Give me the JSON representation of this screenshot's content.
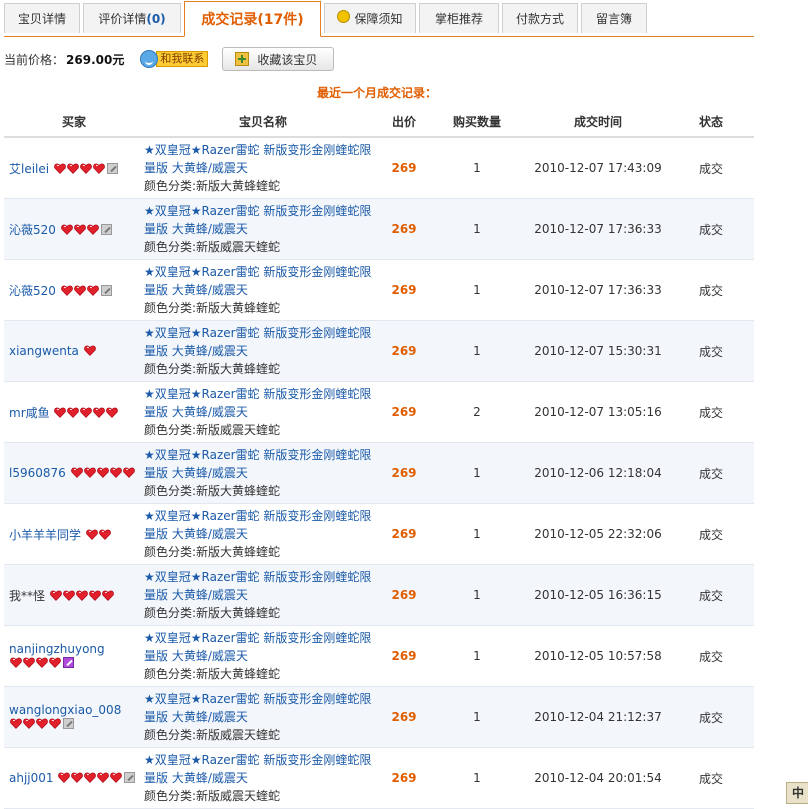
{
  "tabs": [
    {
      "label": "宝贝详情",
      "count": ""
    },
    {
      "label": "评价详情",
      "count": "(0)"
    },
    {
      "label": "成交记录",
      "count": "(17件)"
    },
    {
      "label": "保障须知",
      "count": ""
    },
    {
      "label": "掌柜推荐",
      "count": ""
    },
    {
      "label": "付款方式",
      "count": ""
    },
    {
      "label": "留言簿",
      "count": ""
    }
  ],
  "price": {
    "label": "当前价格：",
    "value": "269.00元"
  },
  "contact_label": "和我联系",
  "favorite_label": "收藏该宝贝",
  "section_title": "最近一个月成交记录：",
  "columns": [
    "买家",
    "宝贝名称",
    "出价",
    "购买数量",
    "成交时间",
    "状态"
  ],
  "records": [
    {
      "buyer": "艾leilei",
      "hearts": 4,
      "vip": "gray",
      "item_title": "★双皇冠★Razer雷蛇 新版变形金刚蝰蛇限量版 大黄蜂/威震天",
      "item_attr": "颜色分类:新版大黄蜂蝰蛇",
      "price": "269",
      "qty": "1",
      "time": "2010-12-07 17:43:09",
      "status": "成交"
    },
    {
      "buyer": "沁薇520",
      "hearts": 3,
      "vip": "gray",
      "item_title": "★双皇冠★Razer雷蛇 新版变形金刚蝰蛇限量版 大黄蜂/威震天",
      "item_attr": "颜色分类:新版威震天蝰蛇",
      "price": "269",
      "qty": "1",
      "time": "2010-12-07 17:36:33",
      "status": "成交"
    },
    {
      "buyer": "沁薇520",
      "hearts": 3,
      "vip": "gray",
      "item_title": "★双皇冠★Razer雷蛇 新版变形金刚蝰蛇限量版 大黄蜂/威震天",
      "item_attr": "颜色分类:新版大黄蜂蝰蛇",
      "price": "269",
      "qty": "1",
      "time": "2010-12-07 17:36:33",
      "status": "成交"
    },
    {
      "buyer": "xiangwenta",
      "hearts": 1,
      "vip": "",
      "item_title": "★双皇冠★Razer雷蛇 新版变形金刚蝰蛇限量版 大黄蜂/威震天",
      "item_attr": "颜色分类:新版大黄蜂蝰蛇",
      "price": "269",
      "qty": "1",
      "time": "2010-12-07 15:30:31",
      "status": "成交"
    },
    {
      "buyer": "mr咸鱼",
      "hearts": 5,
      "vip": "",
      "item_title": "★双皇冠★Razer雷蛇 新版变形金刚蝰蛇限量版 大黄蜂/威震天",
      "item_attr": "颜色分类:新版威震天蝰蛇",
      "price": "269",
      "qty": "2",
      "time": "2010-12-07 13:05:16",
      "status": "成交"
    },
    {
      "buyer": "l5960876",
      "hearts": 5,
      "vip": "",
      "item_title": "★双皇冠★Razer雷蛇 新版变形金刚蝰蛇限量版 大黄蜂/威震天",
      "item_attr": "颜色分类:新版大黄蜂蝰蛇",
      "price": "269",
      "qty": "1",
      "time": "2010-12-06 12:18:04",
      "status": "成交"
    },
    {
      "buyer": "小羊羊羊同学",
      "hearts": 2,
      "vip": "",
      "item_title": "★双皇冠★Razer雷蛇 新版变形金刚蝰蛇限量版 大黄蜂/威震天",
      "item_attr": "颜色分类:新版大黄蜂蝰蛇",
      "price": "269",
      "qty": "1",
      "time": "2010-12-05 22:32:06",
      "status": "成交"
    },
    {
      "buyer": "我**怪",
      "hearts": 5,
      "vip": "",
      "item_title": "★双皇冠★Razer雷蛇 新版变形金刚蝰蛇限量版 大黄蜂/威震天",
      "item_attr": "颜色分类:新版大黄蜂蝰蛇",
      "price": "269",
      "qty": "1",
      "time": "2010-12-05 16:36:15",
      "status": "成交"
    },
    {
      "buyer": "nanjingzhuyong",
      "hearts": 4,
      "vip": "purple",
      "item_title": "★双皇冠★Razer雷蛇 新版变形金刚蝰蛇限量版 大黄蜂/威震天",
      "item_attr": "颜色分类:新版大黄蜂蝰蛇",
      "price": "269",
      "qty": "1",
      "time": "2010-12-05 10:57:58",
      "status": "成交"
    },
    {
      "buyer": "wanglongxiao_008",
      "hearts": 4,
      "vip": "gray",
      "item_title": "★双皇冠★Razer雷蛇 新版变形金刚蝰蛇限量版 大黄蜂/威震天",
      "item_attr": "颜色分类:新版威震天蝰蛇",
      "price": "269",
      "qty": "1",
      "time": "2010-12-04 21:12:37",
      "status": "成交"
    },
    {
      "buyer": "ahjj001",
      "hearts": 5,
      "vip": "gray",
      "item_title": "★双皇冠★Razer雷蛇 新版变形金刚蝰蛇限量版 大黄蜂/威震天",
      "item_attr": "颜色分类:新版威震天蝰蛇",
      "price": "269",
      "qty": "1",
      "time": "2010-12-04 20:01:54",
      "status": "成交"
    }
  ],
  "corner_label": "中",
  "colors": {
    "accent": "#e05d00",
    "link": "#1b5aa8",
    "row_alt": "#f3f7fb"
  }
}
